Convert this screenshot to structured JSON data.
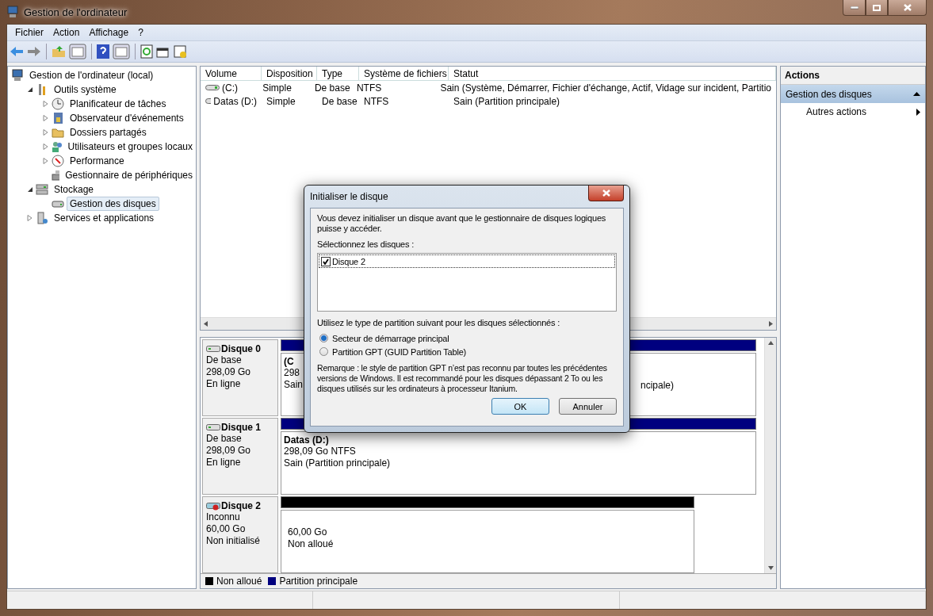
{
  "window": {
    "title": "Gestion de l'ordinateur"
  },
  "menu": [
    "Fichier",
    "Action",
    "Affichage",
    "?"
  ],
  "tree": [
    {
      "label": "Gestion de l'ordinateur (local)",
      "selected": false,
      "children": [
        {
          "label": "Outils système",
          "has_children": true,
          "expanded": true,
          "selected": false,
          "children": [
            {
              "label": "Planificateur de tâches",
              "has_children": true,
              "expanded": false,
              "selected": false
            },
            {
              "label": "Observateur d'événements",
              "has_children": true,
              "expanded": false,
              "selected": false
            },
            {
              "label": "Dossiers partagés",
              "has_children": true,
              "expanded": false,
              "selected": false
            },
            {
              "label": "Utilisateurs et groupes locaux",
              "has_children": true,
              "expanded": false,
              "selected": false
            },
            {
              "label": "Performance",
              "has_children": true,
              "expanded": false,
              "selected": false
            },
            {
              "label": "Gestionnaire de périphériques",
              "has_children": false,
              "expanded": false,
              "selected": false
            }
          ]
        },
        {
          "label": "Stockage",
          "has_children": true,
          "expanded": true,
          "selected": false,
          "children": [
            {
              "label": "Gestion des disques",
              "has_children": false,
              "expanded": false,
              "selected": true
            }
          ]
        },
        {
          "label": "Services et applications",
          "has_children": true,
          "expanded": false,
          "selected": false
        }
      ]
    }
  ],
  "volumes": {
    "columns": [
      "Volume",
      "Disposition",
      "Type",
      "Système de fichiers",
      "Statut"
    ],
    "rows": [
      [
        "(C:)",
        "Simple",
        "De base",
        "NTFS",
        "Sain (Système, Démarrer, Fichier d'échange, Actif, Vidage sur incident, Partitio"
      ],
      [
        "Datas (D:)",
        "Simple",
        "De base",
        "NTFS",
        "Sain (Partition principale)"
      ]
    ]
  },
  "disks": [
    {
      "name": "Disque 0",
      "type": "De base",
      "size": "298,09 Go",
      "status": "En ligne",
      "initialized": true,
      "partitions": [
        {
          "kind": "primary",
          "color": "#00007f",
          "name": "(C",
          "lines": [
            "298",
            "Sain"
          ],
          "trailing": "ncipale)"
        }
      ]
    },
    {
      "name": "Disque 1",
      "type": "De base",
      "size": "298,09 Go",
      "status": "En ligne",
      "initialized": true,
      "partitions": [
        {
          "kind": "primary",
          "color": "#00007f",
          "name": "Datas  (D:)",
          "lines": [
            "298,09 Go NTFS",
            "Sain (Partition principale)"
          ]
        }
      ]
    },
    {
      "name": "Disque 2",
      "type": "Inconnu",
      "size": "60,00 Go",
      "status": "Non initialisé",
      "initialized": false,
      "partitions": [
        {
          "kind": "unallocated",
          "color": "#000000",
          "lines": [
            "60,00 Go",
            "Non alloué"
          ]
        }
      ]
    }
  ],
  "legend": [
    {
      "label": "Non alloué",
      "color": "#000000"
    },
    {
      "label": "Partition principale",
      "color": "#00007f"
    }
  ],
  "actions": {
    "title": "Actions",
    "section": {
      "label": "Gestion des disques",
      "expanded": true
    },
    "items": [
      "Autres actions"
    ]
  },
  "dialog": {
    "title": "Initialiser le disque",
    "intro": "Vous devez initialiser un disque avant que le gestionnaire de disques logiques puisse y accéder.",
    "select_label": "Sélectionnez les disques :",
    "disks": [
      {
        "label": "Disque 2",
        "checked": true,
        "selected": true
      }
    ],
    "partition_label": "Utilisez le type de partition suivant pour les disques sélectionnés :",
    "styles": [
      {
        "label": "Secteur de démarrage principal",
        "selected": true
      },
      {
        "label": "Partition GPT (GUID Partition Table)",
        "selected": false
      }
    ],
    "note": "Remarque : le style de partition GPT n’est pas reconnu par toutes les précédentes versions de Windows. Il est recommandé pour les disques dépassant 2 To ou les disques utilisés sur les ordinateurs à processeur Itanium.",
    "buttons": [
      {
        "label": "OK",
        "default": true
      },
      {
        "label": "Annuler",
        "default": false
      }
    ]
  }
}
